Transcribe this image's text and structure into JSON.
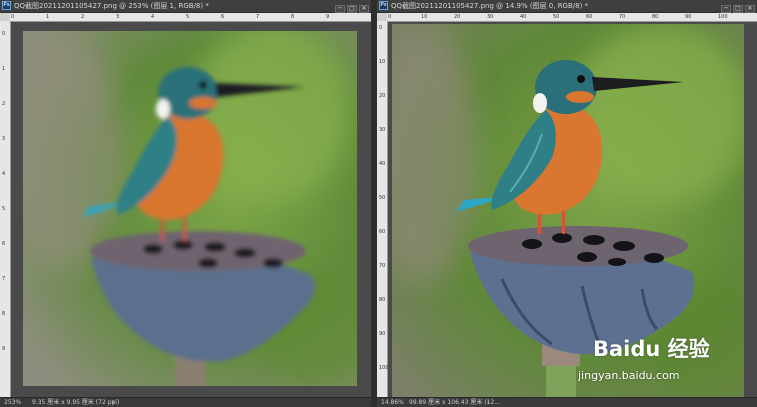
{
  "left_doc": {
    "title": "QQ截图20211201105427.png @ 253% (图层 1, RGB/8) *",
    "icon_text": "Ps",
    "zoom": "253%",
    "doc_info": "9.35 厘米 x 9.95 厘米 (72 ppi)",
    "status_arrow": "›",
    "ruler_top": [
      "0",
      "1",
      "2",
      "3",
      "4",
      "5",
      "6",
      "7",
      "8",
      "9"
    ],
    "ruler_left": [
      "0",
      "1",
      "2",
      "3",
      "4",
      "5",
      "6",
      "7",
      "8",
      "9"
    ]
  },
  "right_doc": {
    "title": "QQ截图20211201105427.png @ 14.9% (图层 0, RGB/8) *",
    "icon_text": "Ps",
    "zoom": "14.86%",
    "doc_info": "99.89 厘米 x 106.43 厘米 (12...",
    "status_arrow": "›",
    "ruler_top": [
      "0",
      "10",
      "20",
      "30",
      "40",
      "50",
      "60",
      "70",
      "80",
      "90",
      "100"
    ],
    "ruler_left": [
      "0",
      "10",
      "20",
      "30",
      "40",
      "50",
      "60",
      "70",
      "80",
      "90",
      "100"
    ],
    "watermark": "Baidu 经验",
    "watermark_url": "jingyan.baidu.com"
  },
  "window_buttons": [
    "─",
    "□",
    "✕"
  ],
  "colors": {
    "workspace": "#4a4a4a",
    "titlebar": "#3f3f3f",
    "ruler": "#e6e6e6",
    "bird_back": "#2f7f86",
    "bird_breast": "#d9762f",
    "bird_head": "#2a6f79",
    "seedpod": "#5c6f8e",
    "background_green": "#6f9a43"
  }
}
